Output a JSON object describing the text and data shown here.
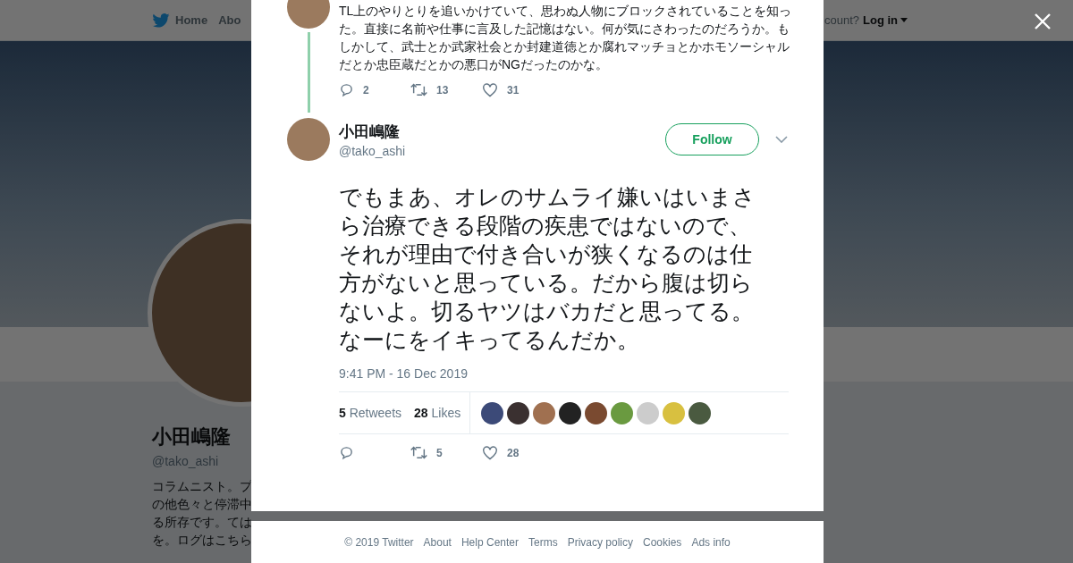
{
  "nav": {
    "items": [
      {
        "label": "Home"
      },
      {
        "label": "Abo"
      }
    ],
    "account_prompt": "count?",
    "login": "Log in"
  },
  "profile": {
    "name": "小田嶋隆",
    "handle": "@tako_ashi",
    "bio_lines": [
      "コラムニスト。プ",
      "の他色々と停滞中",
      "る所存です。ては",
      "を。ログはこちら"
    ]
  },
  "parent_tweet": {
    "text": "TL上のやりとりを追いかけていて、思わぬ人物にブロックされていることを知った。直接に名前や仕事に言及した記憶はない。何が気にさわったのだろうか。もしかして、武士とか武家社会とか封建道徳とか腐れマッチョとかホモソーシャルだとか忠臣蔵だとかの悪口がNGだったのかな。",
    "replies": "2",
    "retweets": "13",
    "likes": "31"
  },
  "tweet": {
    "name": "小田嶋隆",
    "handle": "@tako_ashi",
    "follow": "Follow",
    "text": "でもまあ、オレのサムライ嫌いはいまさら治療できる段階の疾患ではないので、それが理由で付き合いが狭くなるのは仕方がないと思っている。だから腹は切らないよ。切るヤツはバカだと思ってる。なーにをイキってるんだか。",
    "timestamp": "9:41 PM - 16 Dec 2019",
    "retweet_count": "5",
    "retweet_label": "Retweets",
    "like_count": "28",
    "like_label": "Likes",
    "retweets": "5",
    "likes": "28"
  },
  "footer": {
    "links": [
      "© 2019 Twitter",
      "About",
      "Help Center",
      "Terms",
      "Privacy policy",
      "Cookies",
      "Ads info"
    ]
  }
}
